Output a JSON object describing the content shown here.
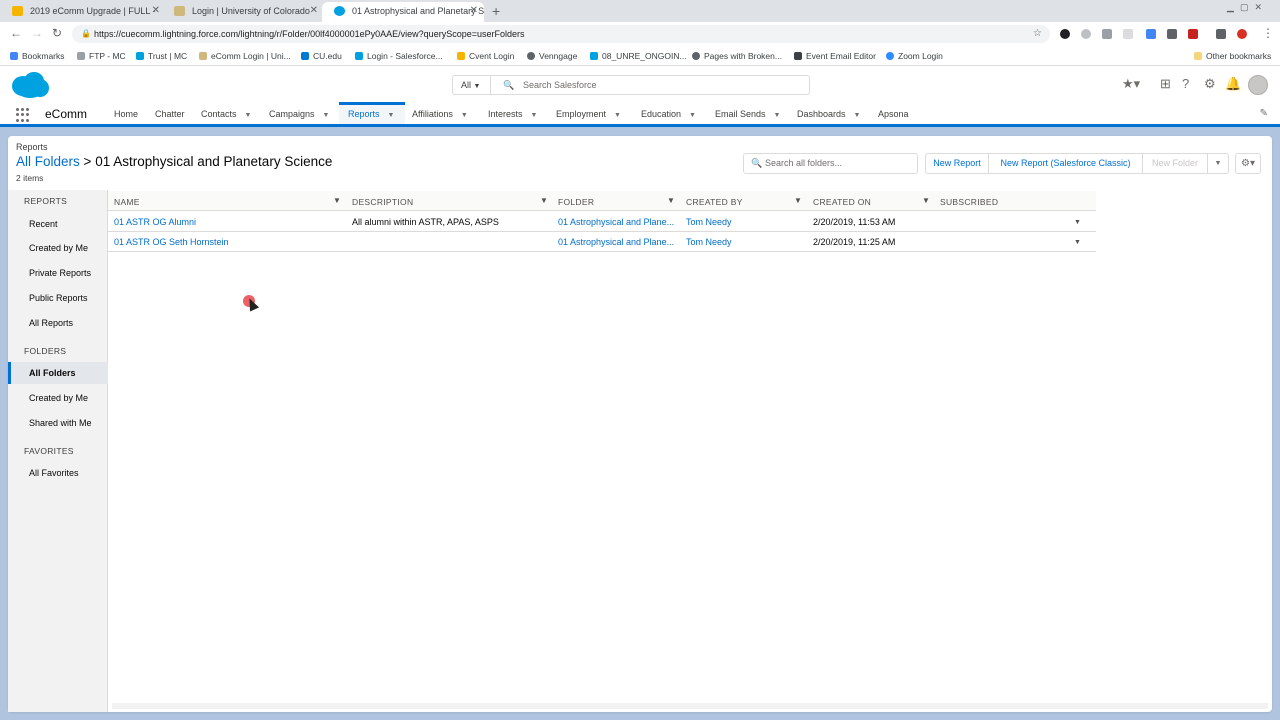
{
  "browser": {
    "tabs": [
      {
        "title": "2019 eComm Upgrade | FULL -",
        "color": "#f4b400"
      },
      {
        "title": "Login | University of Colorado",
        "color": "#cfb87c"
      },
      {
        "title": "01 Astrophysical and Planetary S",
        "color": "#00a1e0"
      }
    ],
    "new_tab": "+",
    "url": "https://cuecomm.lightning.force.com/lightning/r/Folder/00lf4000001ePy0AAE/view?queryScope=userFolders",
    "bookmarks": [
      {
        "label": "Bookmarks",
        "color": "#4285f4"
      },
      {
        "label": "FTP - MC",
        "color": "#9aa0a6"
      },
      {
        "label": "Trust | MC",
        "color": "#00a1e0"
      },
      {
        "label": "eComm Login | Uni...",
        "color": "#cfb87c"
      },
      {
        "label": "CU.edu",
        "color": "#0078d4"
      },
      {
        "label": "Login - Salesforce...",
        "color": "#00a1e0"
      },
      {
        "label": "Cvent Login",
        "color": "#f4b400"
      },
      {
        "label": "Venngage",
        "color": "#5f6368"
      },
      {
        "label": "08_UNRE_ONGOIN...",
        "color": "#00a1e0"
      },
      {
        "label": "Pages with Broken...",
        "color": "#5f6368"
      },
      {
        "label": "Event Email Editor",
        "color": "#3c4043"
      },
      {
        "label": "Zoom Login",
        "color": "#2d8cff"
      }
    ],
    "other_bookmarks": "Other bookmarks"
  },
  "header": {
    "search_scope": "All",
    "search_placeholder": "Search Salesforce"
  },
  "app": {
    "name": "eComm",
    "nav": [
      {
        "label": "Home",
        "chevron": false
      },
      {
        "label": "Chatter",
        "chevron": false
      },
      {
        "label": "Contacts",
        "chevron": true
      },
      {
        "label": "Campaigns",
        "chevron": true
      },
      {
        "label": "Reports",
        "chevron": true,
        "active": true
      },
      {
        "label": "Affiliations",
        "chevron": true
      },
      {
        "label": "Interests",
        "chevron": true
      },
      {
        "label": "Employment",
        "chevron": true
      },
      {
        "label": "Education",
        "chevron": true
      },
      {
        "label": "Email Sends",
        "chevron": true
      },
      {
        "label": "Dashboards",
        "chevron": true
      },
      {
        "label": "Apsona",
        "chevron": false
      }
    ]
  },
  "page": {
    "breadcrumb": "Reports",
    "title_link": "All Folders",
    "title_separator": ">",
    "title": "01 Astrophysical and Planetary Science",
    "item_count": "2 items",
    "folder_search_placeholder": "Search all folders...",
    "new_report": "New Report",
    "new_report_classic": "New Report (Salesforce Classic)",
    "new_folder": "New Folder"
  },
  "sidebar": {
    "reports_heading": "REPORTS",
    "reports_items": [
      "Recent",
      "Created by Me",
      "Private Reports",
      "Public Reports",
      "All Reports"
    ],
    "folders_heading": "FOLDERS",
    "folders_items": [
      "All Folders",
      "Created by Me",
      "Shared with Me"
    ],
    "favorites_heading": "FAVORITES",
    "favorites_items": [
      "All Favorites"
    ]
  },
  "table": {
    "columns": [
      "NAME",
      "DESCRIPTION",
      "FOLDER",
      "CREATED BY",
      "CREATED ON",
      "SUBSCRIBED"
    ],
    "rows": [
      {
        "name": "01 ASTR OG Alumni",
        "description": "All alumni within ASTR, APAS, ASPS",
        "folder": "01 Astrophysical and Plane...",
        "created_by": "Tom Needy",
        "created_on": "2/20/2019, 11:53 AM",
        "subscribed": ""
      },
      {
        "name": "01 ASTR OG Seth Hornstein",
        "description": "",
        "folder": "01 Astrophysical and Plane...",
        "created_by": "Tom Needy",
        "created_on": "2/20/2019, 11:25 AM",
        "subscribed": ""
      }
    ]
  },
  "colors": {
    "brand": "#0070d2",
    "link": "#006dcc",
    "background": "#b0c4df"
  }
}
